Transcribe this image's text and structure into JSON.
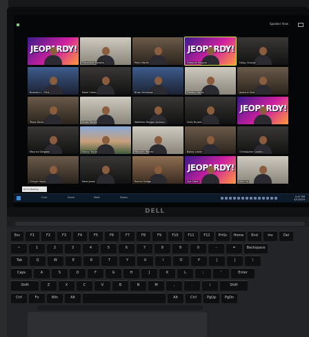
{
  "photo": {
    "subject": "laptop-showing-video-call"
  },
  "screen": {
    "topbar": {
      "view_label": "Speaker View"
    },
    "gallery": {
      "tiles": [
        {
          "name": "",
          "bg": "jeopardy"
        },
        {
          "name": "Francesca Morales",
          "bg": "light"
        },
        {
          "name": "Peter Martin",
          "bg": "room"
        },
        {
          "name": "Deborah Rosario",
          "bg": "jeopardy"
        },
        {
          "name": "Daisy Chavez",
          "bg": "dark"
        },
        {
          "name": "Brandon L. Ortiz",
          "bg": "blue"
        },
        {
          "name": "Noah Cohen",
          "bg": "dark"
        },
        {
          "name": "Brian Nicholson",
          "bg": "blue"
        },
        {
          "name": "Destiny Harris",
          "bg": "light"
        },
        {
          "name": "Jasmine Hart",
          "bg": "room"
        },
        {
          "name": "Tessa Davis",
          "bg": "room"
        },
        {
          "name": "Angie Kerala",
          "bg": "light"
        },
        {
          "name": "Matthew Morgan Jackson",
          "bg": "dark"
        },
        {
          "name": "Holly Bryant",
          "bg": "dark"
        },
        {
          "name": "",
          "bg": "jeopardy"
        },
        {
          "name": "Maurice Delgado",
          "bg": "dark"
        },
        {
          "name": "Nancy Taylor",
          "bg": "sky"
        },
        {
          "name": "Malcolm Warren",
          "bg": "light"
        },
        {
          "name": "Bailey Lanier",
          "bg": "room"
        },
        {
          "name": "Christopher Castillo",
          "bg": "dark"
        },
        {
          "name": "Chinye Hayes",
          "bg": "room"
        },
        {
          "name": "Nora Jones",
          "bg": "dark"
        },
        {
          "name": "Rachel Dodge",
          "bg": "shelf"
        },
        {
          "name": "Ava Clark",
          "bg": "jeopardy"
        },
        {
          "name": "Alan Lo",
          "bg": "light"
        }
      ],
      "jeopardy_logo_text": "JEOPARDY!",
      "active_speaker_index": 3
    },
    "taskbar": {
      "tooltip": "Zoom Meeting",
      "items": [
        "Chat",
        "Zoom",
        "Meet",
        "Teams"
      ],
      "time": "2:47 PM",
      "date": "4/1/2024"
    }
  },
  "laptop": {
    "brand": "DELL"
  },
  "keyboard": {
    "rows": [
      [
        "Esc",
        "F1",
        "F2",
        "F3",
        "F4",
        "F5",
        "F6",
        "F7",
        "F8",
        "F9",
        "F10",
        "F11",
        "F12",
        "PrtSc",
        "Home",
        "End",
        "Ins",
        "Del"
      ],
      [
        "~",
        "1",
        "2",
        "3",
        "4",
        "5",
        "6",
        "7",
        "8",
        "9",
        "0",
        "-",
        "=",
        "Backspace"
      ],
      [
        "Tab",
        "Q",
        "W",
        "E",
        "R",
        "T",
        "Y",
        "U",
        "I",
        "O",
        "P",
        "[",
        "]",
        "\\"
      ],
      [
        "Caps",
        "A",
        "S",
        "D",
        "F",
        "G",
        "H",
        "J",
        "K",
        "L",
        ";",
        "'",
        "Enter"
      ],
      [
        "Shift",
        "Z",
        "X",
        "C",
        "V",
        "B",
        "N",
        "M",
        ",",
        ".",
        "/",
        "Shift"
      ],
      [
        "Ctrl",
        "Fn",
        "Win",
        "Alt",
        "",
        "Alt",
        "Ctrl",
        "PgUp",
        "PgDn"
      ]
    ],
    "trackpoint_color": "#2a7fd4"
  },
  "colors": {
    "active_border": "#d7e84a",
    "taskbar": "#0d1a2a"
  }
}
